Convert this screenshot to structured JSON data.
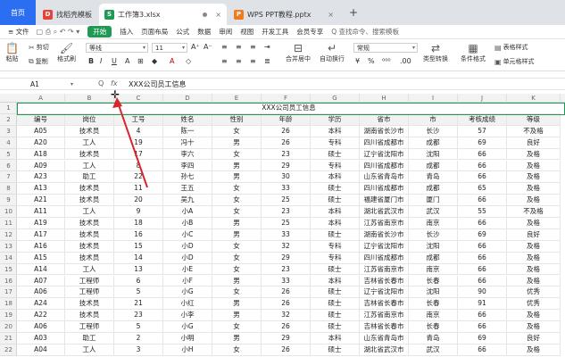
{
  "tabs": {
    "home": "首页",
    "items": [
      {
        "label": "找稻壳模板",
        "icon": "D",
        "color": "#e8413a"
      },
      {
        "label": "工作簿3.xlsx",
        "icon": "S",
        "color": "#1e9a55"
      },
      {
        "label": "WPS PPT教程.pptx",
        "icon": "P",
        "color": "#f07a1c"
      }
    ],
    "new_tab": "+"
  },
  "menu": {
    "file": "≡ 文件",
    "items": [
      "开始",
      "插入",
      "页面布局",
      "公式",
      "数据",
      "审阅",
      "视图",
      "开发工具",
      "会员专享"
    ],
    "search": "Q 查找命令、搜索模板"
  },
  "ribbon": {
    "paste": "粘贴",
    "cut": "剪切",
    "copy": "复制",
    "format_painter": "格式刷",
    "font_name": "等线",
    "font_size": "11",
    "bold": "B",
    "italic": "I",
    "underline": "U",
    "merge": "合并居中",
    "wrap": "自动换行",
    "number_format": "常规",
    "currency": "¥",
    "percent": "%",
    "type_convert": "类型转换",
    "cond_format": "条件格式",
    "table_style": "表格样式",
    "cell_style": "单元格样式"
  },
  "formula_bar": {
    "name_box": "A1",
    "fx": "fx",
    "zoom_icon": "Q",
    "content": "XXX公司员工信息"
  },
  "columns": [
    "A",
    "B",
    "C",
    "D",
    "E",
    "F",
    "G",
    "H",
    "I",
    "J",
    "K"
  ],
  "title_row": "XXX公司员工信息",
  "headers": [
    "编号",
    "岗位",
    "工号",
    "姓名",
    "性别",
    "年龄",
    "学历",
    "省市",
    "市",
    "考核成绩",
    "等级"
  ],
  "rows": [
    [
      "A05",
      "技术员",
      "4",
      "陈一",
      "女",
      "26",
      "本科",
      "湖南省长沙市",
      "长沙",
      "57",
      "不及格"
    ],
    [
      "A20",
      "工人",
      "19",
      "冯十",
      "男",
      "26",
      "专科",
      "四川省成都市",
      "成都",
      "69",
      "良好"
    ],
    [
      "A18",
      "技术员",
      "17",
      "李六",
      "女",
      "23",
      "硕士",
      "辽宁省沈阳市",
      "沈阳",
      "66",
      "及格"
    ],
    [
      "A09",
      "工人",
      "8",
      "李四",
      "男",
      "29",
      "专科",
      "四川省成都市",
      "成都",
      "66",
      "及格"
    ],
    [
      "A23",
      "助工",
      "22",
      "孙七",
      "男",
      "30",
      "本科",
      "山东省青岛市",
      "青岛",
      "66",
      "及格"
    ],
    [
      "A13",
      "技术员",
      "11",
      "王五",
      "女",
      "33",
      "硕士",
      "四川省成都市",
      "成都",
      "65",
      "及格"
    ],
    [
      "A21",
      "技术员",
      "20",
      "吴九",
      "女",
      "25",
      "硕士",
      "福建省厦门市",
      "厦门",
      "66",
      "及格"
    ],
    [
      "A11",
      "工人",
      "9",
      "小A",
      "女",
      "23",
      "本科",
      "湖北省武汉市",
      "武汉",
      "55",
      "不及格"
    ],
    [
      "A19",
      "技术员",
      "18",
      "小B",
      "男",
      "25",
      "本科",
      "江苏省南京市",
      "南京",
      "66",
      "及格"
    ],
    [
      "A17",
      "技术员",
      "16",
      "小C",
      "男",
      "33",
      "硕士",
      "湖南省长沙市",
      "长沙",
      "69",
      "良好"
    ],
    [
      "A16",
      "技术员",
      "15",
      "小D",
      "女",
      "32",
      "专科",
      "辽宁省沈阳市",
      "沈阳",
      "66",
      "及格"
    ],
    [
      "A15",
      "技术员",
      "14",
      "小D",
      "女",
      "29",
      "专科",
      "四川省成都市",
      "成都",
      "66",
      "及格"
    ],
    [
      "A14",
      "工人",
      "13",
      "小E",
      "女",
      "23",
      "硕士",
      "江苏省南京市",
      "南京",
      "66",
      "及格"
    ],
    [
      "A07",
      "工程师",
      "6",
      "小F",
      "男",
      "33",
      "本科",
      "吉林省长春市",
      "长春",
      "66",
      "及格"
    ],
    [
      "A06",
      "工程师",
      "5",
      "小G",
      "女",
      "26",
      "硕士",
      "辽宁省沈阳市",
      "沈阳",
      "90",
      "优秀"
    ],
    [
      "A24",
      "技术员",
      "21",
      "小红",
      "男",
      "26",
      "硕士",
      "吉林省长春市",
      "长春",
      "91",
      "优秀"
    ],
    [
      "A22",
      "技术员",
      "23",
      "小李",
      "男",
      "32",
      "硕士",
      "江苏省南京市",
      "南京",
      "66",
      "及格"
    ],
    [
      "A06",
      "工程师",
      "5",
      "小G",
      "女",
      "26",
      "硕士",
      "吉林省长春市",
      "长春",
      "66",
      "及格"
    ],
    [
      "A03",
      "助工",
      "2",
      "小明",
      "男",
      "29",
      "本科",
      "山东省青岛市",
      "青岛",
      "69",
      "良好"
    ],
    [
      "A04",
      "工人",
      "3",
      "小H",
      "女",
      "26",
      "硕士",
      "湖北省武汉市",
      "武汉",
      "66",
      "及格"
    ]
  ],
  "accent": "#1e9a55",
  "arrow_color": "#d8262e"
}
